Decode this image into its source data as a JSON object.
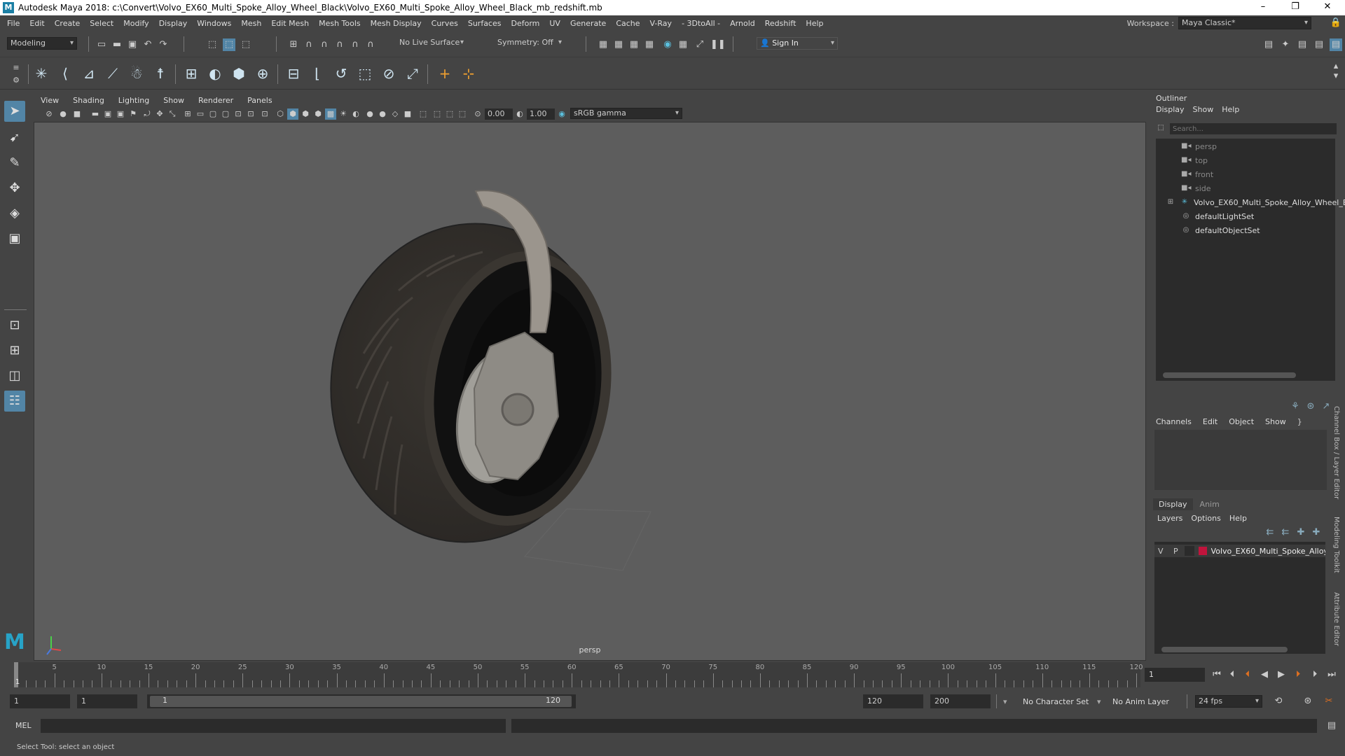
{
  "window": {
    "title": "Autodesk Maya 2018: c:\\Convert\\Volvo_EX60_Multi_Spoke_Alloy_Wheel_Black\\Volvo_EX60_Multi_Spoke_Alloy_Wheel_Black_mb_redshift.mb",
    "minimize": "–",
    "maximize": "❐",
    "close": "✕"
  },
  "menus": [
    "File",
    "Edit",
    "Create",
    "Select",
    "Modify",
    "Display",
    "Windows",
    "Mesh",
    "Edit Mesh",
    "Mesh Tools",
    "Mesh Display",
    "Curves",
    "Surfaces",
    "Deform",
    "UV",
    "Generate",
    "Cache",
    "V-Ray",
    "- 3DtoAll -",
    "Arnold",
    "Redshift",
    "Help"
  ],
  "workspace": {
    "label": "Workspace :",
    "value": "Maya Classic*"
  },
  "status": {
    "mode": "Modeling",
    "live_surface": "No Live Surface",
    "symmetry": "Symmetry: Off",
    "sign_in": "Sign In"
  },
  "panel_menus": [
    "View",
    "Shading",
    "Lighting",
    "Show",
    "Renderer",
    "Panels"
  ],
  "panel_tools": {
    "exposure": "0.00",
    "gamma": "1.00",
    "color_space": "sRGB gamma"
  },
  "viewport": {
    "camera_label": "persp"
  },
  "outliner": {
    "title": "Outliner",
    "menus": [
      "Display",
      "Show",
      "Help"
    ],
    "search_placeholder": "Search...",
    "items": [
      {
        "label": "persp",
        "icon": "camera-icon",
        "dim": true
      },
      {
        "label": "top",
        "icon": "camera-icon",
        "dim": true
      },
      {
        "label": "front",
        "icon": "camera-icon",
        "dim": true
      },
      {
        "label": "side",
        "icon": "camera-icon",
        "dim": true
      },
      {
        "label": "Volvo_EX60_Multi_Spoke_Alloy_Wheel_E",
        "icon": "group-icon",
        "dim": false
      },
      {
        "label": "defaultLightSet",
        "icon": "set-icon",
        "dim": false
      },
      {
        "label": "defaultObjectSet",
        "icon": "set-icon",
        "dim": false
      }
    ]
  },
  "channel_box": {
    "menus": [
      "Channels",
      "Edit",
      "Object",
      "Show"
    ]
  },
  "layer_editor": {
    "tabs": [
      "Display",
      "Anim"
    ],
    "menus": [
      "Layers",
      "Options",
      "Help"
    ],
    "layer": {
      "v": "V",
      "p": "P",
      "name": "Volvo_EX60_Multi_Spoke_Alloy",
      "color": "#c0143c"
    }
  },
  "side_tabs": [
    "Channel Box / Layer Editor",
    "Modeling Toolkit",
    "Attribute Editor"
  ],
  "timeline": {
    "ticks": [
      5,
      10,
      15,
      20,
      25,
      30,
      35,
      40,
      45,
      50,
      55,
      60,
      65,
      70,
      75,
      80,
      85,
      90,
      95,
      100,
      105,
      110,
      115,
      120
    ],
    "current_frame": "1",
    "start": "1",
    "end": "120",
    "current_marker": "1"
  },
  "range": {
    "start": "1",
    "start2": "1",
    "slider_start": "1",
    "slider_end": "120",
    "end": "120",
    "end2": "200",
    "character_set": "No Character Set",
    "anim_layer": "No Anim Layer",
    "fps": "24 fps"
  },
  "mel": {
    "label": "MEL"
  },
  "help_line": "Select Tool: select an object"
}
